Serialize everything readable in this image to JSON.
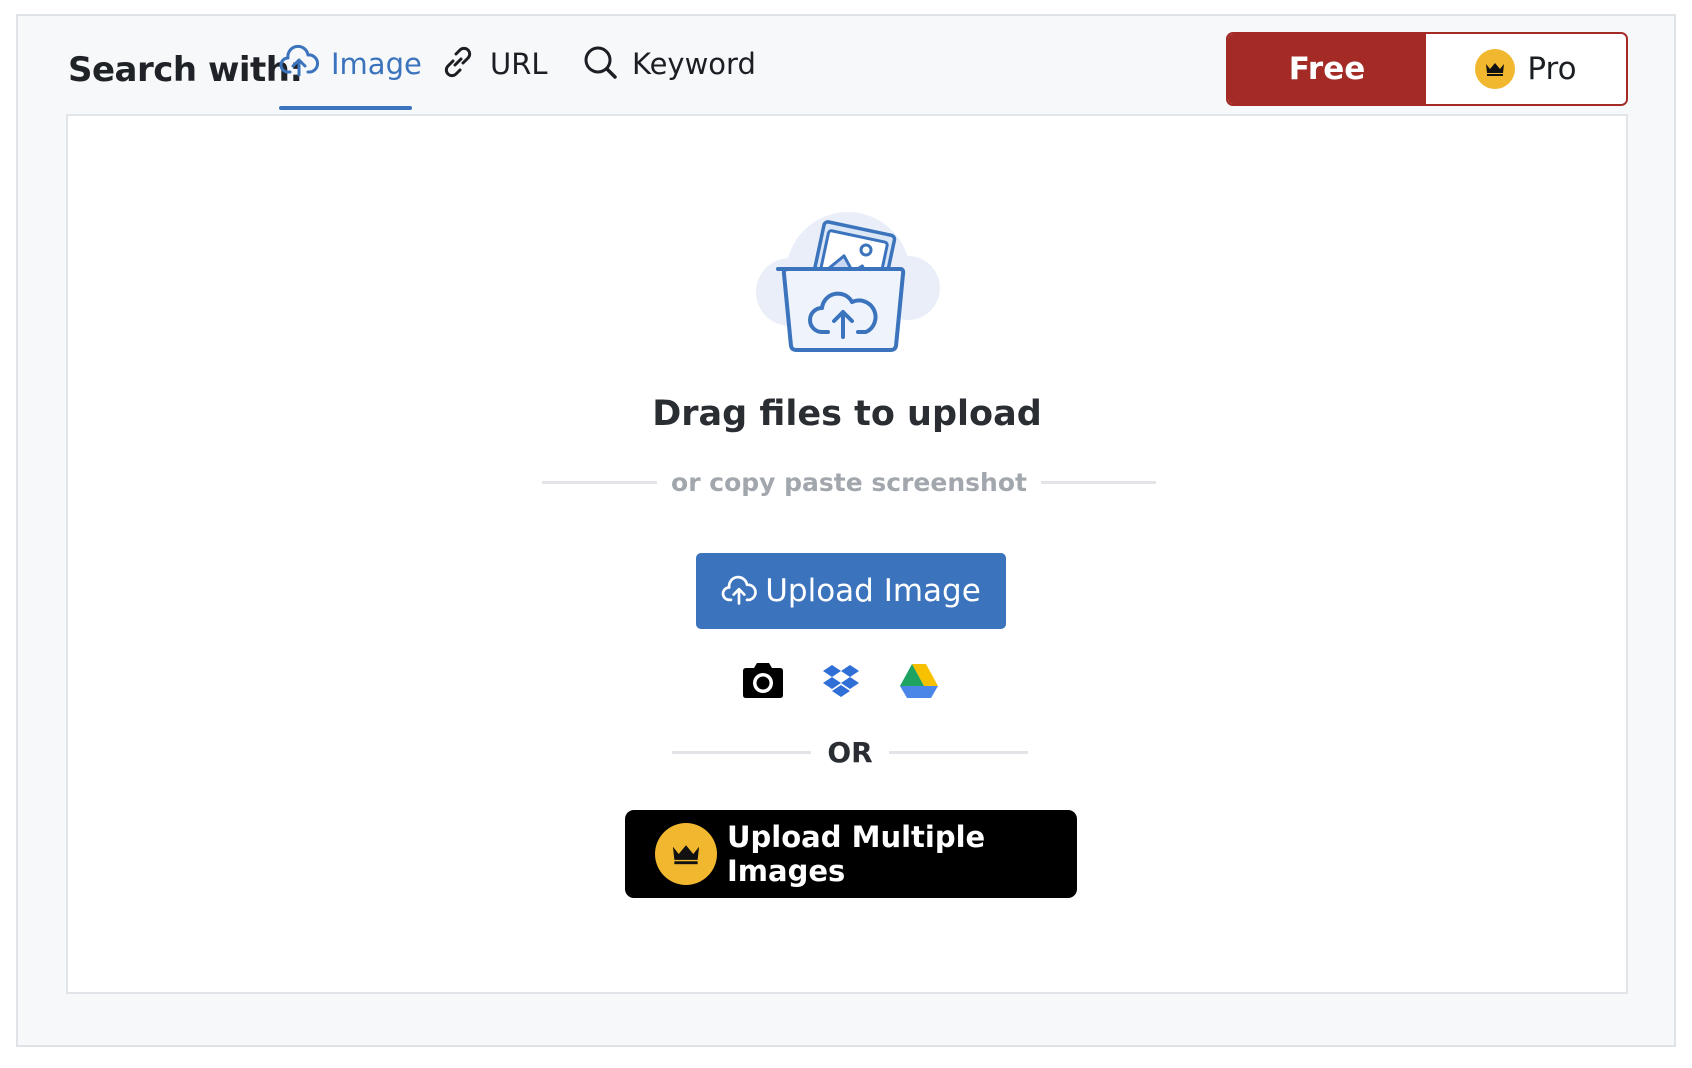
{
  "header": {
    "search_label": "Search with:",
    "tabs": [
      {
        "label": "Image",
        "icon": "cloud-upload-icon",
        "active": true
      },
      {
        "label": "URL",
        "icon": "link-icon",
        "active": false
      },
      {
        "label": "Keyword",
        "icon": "search-icon",
        "active": false
      }
    ],
    "plan": {
      "free_label": "Free",
      "pro_label": "Pro",
      "pro_icon": "crown-icon"
    }
  },
  "upload": {
    "illustration": "folder-cloud-upload-icon",
    "drag_title": "Drag files to upload",
    "paste_hint": "or copy paste screenshot",
    "upload_button": "Upload Image",
    "sources": [
      "camera-icon",
      "dropbox-icon",
      "google-drive-icon"
    ],
    "or_label": "OR",
    "multi_button": "Upload Multiple Images"
  },
  "colors": {
    "accent_blue": "#3b73bd",
    "free_red": "#a32a25",
    "crown_gold": "#f1b72f"
  }
}
